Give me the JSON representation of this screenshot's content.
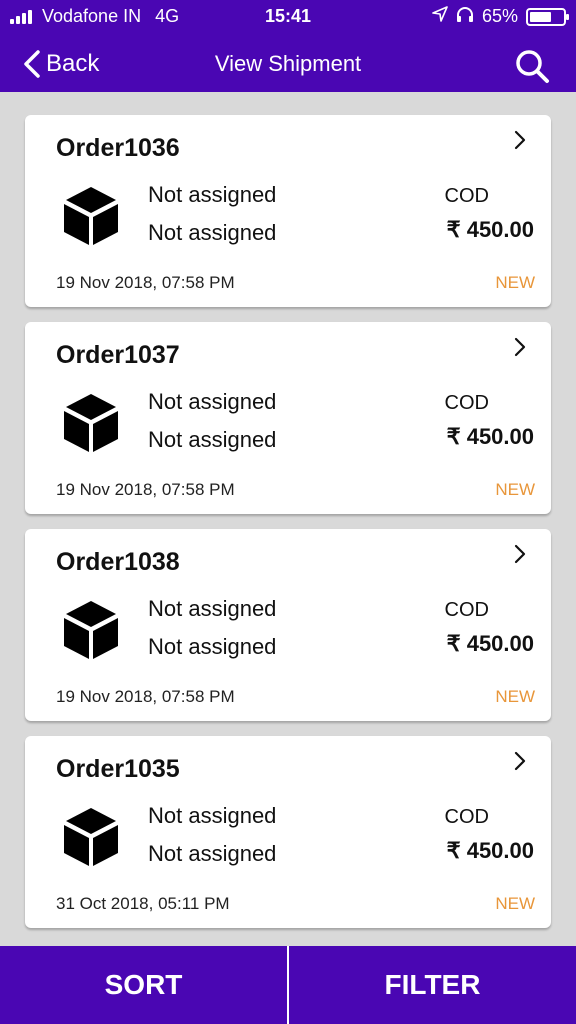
{
  "status_bar": {
    "carrier": "Vodafone IN",
    "network": "4G",
    "time": "15:41",
    "battery_text": "65%",
    "battery_level": 0.65
  },
  "nav": {
    "back_label": "Back",
    "title": "View Shipment"
  },
  "orders": [
    {
      "id": "Order1036",
      "name1": "Not assigned",
      "name2": "Not assigned",
      "payment": "COD",
      "amount": "₹ 450.00",
      "date": "19 Nov 2018, 07:58 PM",
      "status": "NEW"
    },
    {
      "id": "Order1037",
      "name1": "Not assigned",
      "name2": "Not assigned",
      "payment": "COD",
      "amount": "₹ 450.00",
      "date": "19 Nov 2018, 07:58 PM",
      "status": "NEW"
    },
    {
      "id": "Order1038",
      "name1": "Not assigned",
      "name2": "Not assigned",
      "payment": "COD",
      "amount": "₹ 450.00",
      "date": "19 Nov 2018, 07:58 PM",
      "status": "NEW"
    },
    {
      "id": "Order1035",
      "name1": "Not assigned",
      "name2": "Not assigned",
      "payment": "COD",
      "amount": "₹ 450.00",
      "date": "31 Oct 2018, 05:11 PM",
      "status": "NEW"
    }
  ],
  "bottom": {
    "sort_label": "SORT",
    "filter_label": "FILTER"
  },
  "colors": {
    "brand": "#4a06b3",
    "status_new": "#e8963a",
    "background": "#d9d9d9"
  },
  "icons": [
    "signal-icon",
    "location-arrow-icon",
    "headphones-icon",
    "battery-icon",
    "back-chevron-icon",
    "search-icon",
    "chevron-right-icon",
    "package-box-icon"
  ]
}
